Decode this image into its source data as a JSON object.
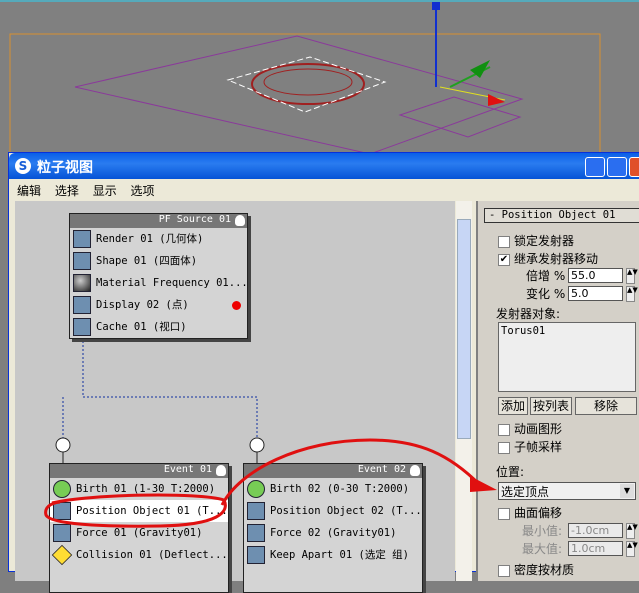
{
  "window": {
    "title": "粒子视图",
    "logo": "3ds-max-logo"
  },
  "menu": [
    "编辑",
    "选择",
    "显示",
    "选项"
  ],
  "pf_source": {
    "title": "PF Source 01",
    "items": [
      {
        "label": "Render 01 (几何体)",
        "icon": "teapot-icon"
      },
      {
        "label": "Shape 01 (四面体)",
        "icon": "cube-icon"
      },
      {
        "label": "Material Frequency 01...",
        "icon": "sphere-icon"
      },
      {
        "label": "Display 02 (点)",
        "icon": "display-icon"
      },
      {
        "label": "Cache 01 (视口)",
        "icon": "cache-icon"
      }
    ]
  },
  "event1": {
    "title": "Event 01",
    "items": [
      {
        "label": "Birth 01 (1-30 T:2000)",
        "icon": "birth-icon"
      },
      {
        "label": "Position Object 01 (T...",
        "icon": "position-icon"
      },
      {
        "label": "Force 01 (Gravity01)",
        "icon": "force-icon"
      },
      {
        "label": "Collision 01 (Deflect...",
        "icon": "collision-icon"
      }
    ]
  },
  "event2": {
    "title": "Event 02",
    "items": [
      {
        "label": "Birth 02 (0-30 T:2000)",
        "icon": "birth-icon"
      },
      {
        "label": "Position Object 02 (T...",
        "icon": "position-icon"
      },
      {
        "label": "Force 02 (Gravity01)",
        "icon": "force-icon"
      },
      {
        "label": "Keep Apart 01 (选定 组)",
        "icon": "keep-apart-icon"
      }
    ]
  },
  "panel": {
    "rollout": "-  Position Object 01",
    "lock_emitter": "锁定发射器",
    "lock_checked": false,
    "inherit": "继承发射器移动",
    "inherit_checked": true,
    "multiplier_label": "倍增 %",
    "multiplier": "55.0",
    "variation_label": "变化 %",
    "variation": "5.0",
    "emitter_objects": "发射器对象:",
    "objects": [
      "Torus01"
    ],
    "add": "添加",
    "by_list": "按列表",
    "remove": "移除",
    "animated_shape": "动画图形",
    "subframe": "子帧采样",
    "location_label": "位置:",
    "location": "选定顶点",
    "surface_offset": "曲面偏移",
    "min_label": "最小值:",
    "min": "-1.0cm",
    "max_label": "最大值:",
    "max": "1.0cm",
    "density": "密度按材质"
  },
  "colors": {
    "annotation": "#e01010",
    "titlebar": "#0a5fe8"
  }
}
